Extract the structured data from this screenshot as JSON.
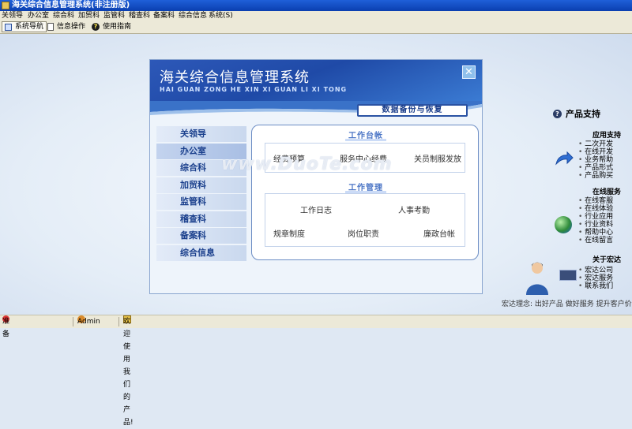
{
  "window": {
    "title": "海关综合信息管理系统(非注册版)"
  },
  "menu": [
    "关领导",
    "办公室",
    "综合科",
    "加贸科",
    "监管科",
    "稽查科",
    "备案科",
    "综合信息",
    "系统(S)"
  ],
  "toolbar": {
    "nav_label": "系统导航",
    "info_label": "信息操作",
    "guide_label": "使用指南"
  },
  "panel": {
    "title": "海关综合信息管理系统",
    "subtitle": "HAI GUAN ZONG HE XIN XI GUAN LI XI TONG",
    "backup_label": "数据备份与恢复",
    "nav": [
      "关领导",
      "办公室",
      "综合科",
      "加贸科",
      "监管科",
      "稽查科",
      "备案科",
      "综合信息"
    ],
    "ledger": {
      "title": "工作台帐",
      "items": [
        "经费预算",
        "服务中心经费",
        "关员制服发放"
      ]
    },
    "management": {
      "title": "工作管理",
      "row1": [
        "工作日志",
        "人事考勤"
      ],
      "row2": [
        "规章制度",
        "岗位职责",
        "廉政台帐"
      ]
    }
  },
  "watermark": "www.DuoTe.com",
  "support": {
    "title": "产品支持",
    "app_title": "应用支持",
    "app_items": [
      "二次开发",
      "在线开发",
      "业务帮助",
      "产品形式",
      "产品购买"
    ],
    "online_title": "在线服务",
    "online_items": [
      "在线客服",
      "在线体验",
      "行业应用",
      "行业资料",
      "帮助中心",
      "在线留言"
    ],
    "about_title": "关于宏达",
    "about_items": [
      "宏达公司",
      "宏达服务",
      "联系我们"
    ]
  },
  "footer_text": "宏达理念: 出好产品  做好服务  提升客户价值",
  "status": {
    "ready": "准备",
    "user": "Admin",
    "welcome": "欢迎使用我们的产品!"
  }
}
